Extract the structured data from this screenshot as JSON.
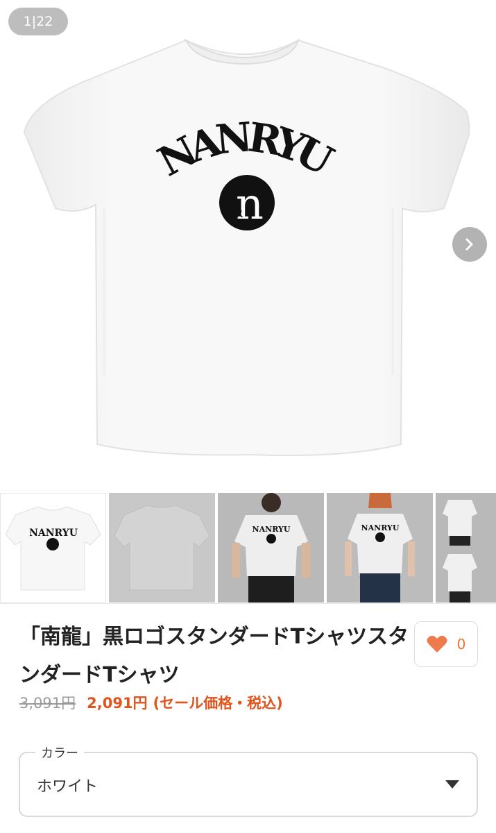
{
  "gallery": {
    "counter": "1|22",
    "print_text": "NANRYU",
    "logo_letter": "n",
    "logo_sub": "R",
    "thumbnails": [
      {
        "alt": "front-white"
      },
      {
        "alt": "back-white"
      },
      {
        "alt": "model-male"
      },
      {
        "alt": "model-female"
      },
      {
        "alt": "model-front-back"
      }
    ]
  },
  "product": {
    "title": "「南龍」黒ロゴスタンダードTシャツスタンダードTシャツ",
    "favorite_count": "0",
    "original_price": "3,091円",
    "sale_price": "2,091円",
    "sale_note": "(セール価格・税込)"
  },
  "color_select": {
    "label": "カラー",
    "value": "ホワイト"
  },
  "colors": {
    "accent": "#e0541e",
    "heart": "#ef7b4c",
    "border": "#d9d9d9"
  }
}
